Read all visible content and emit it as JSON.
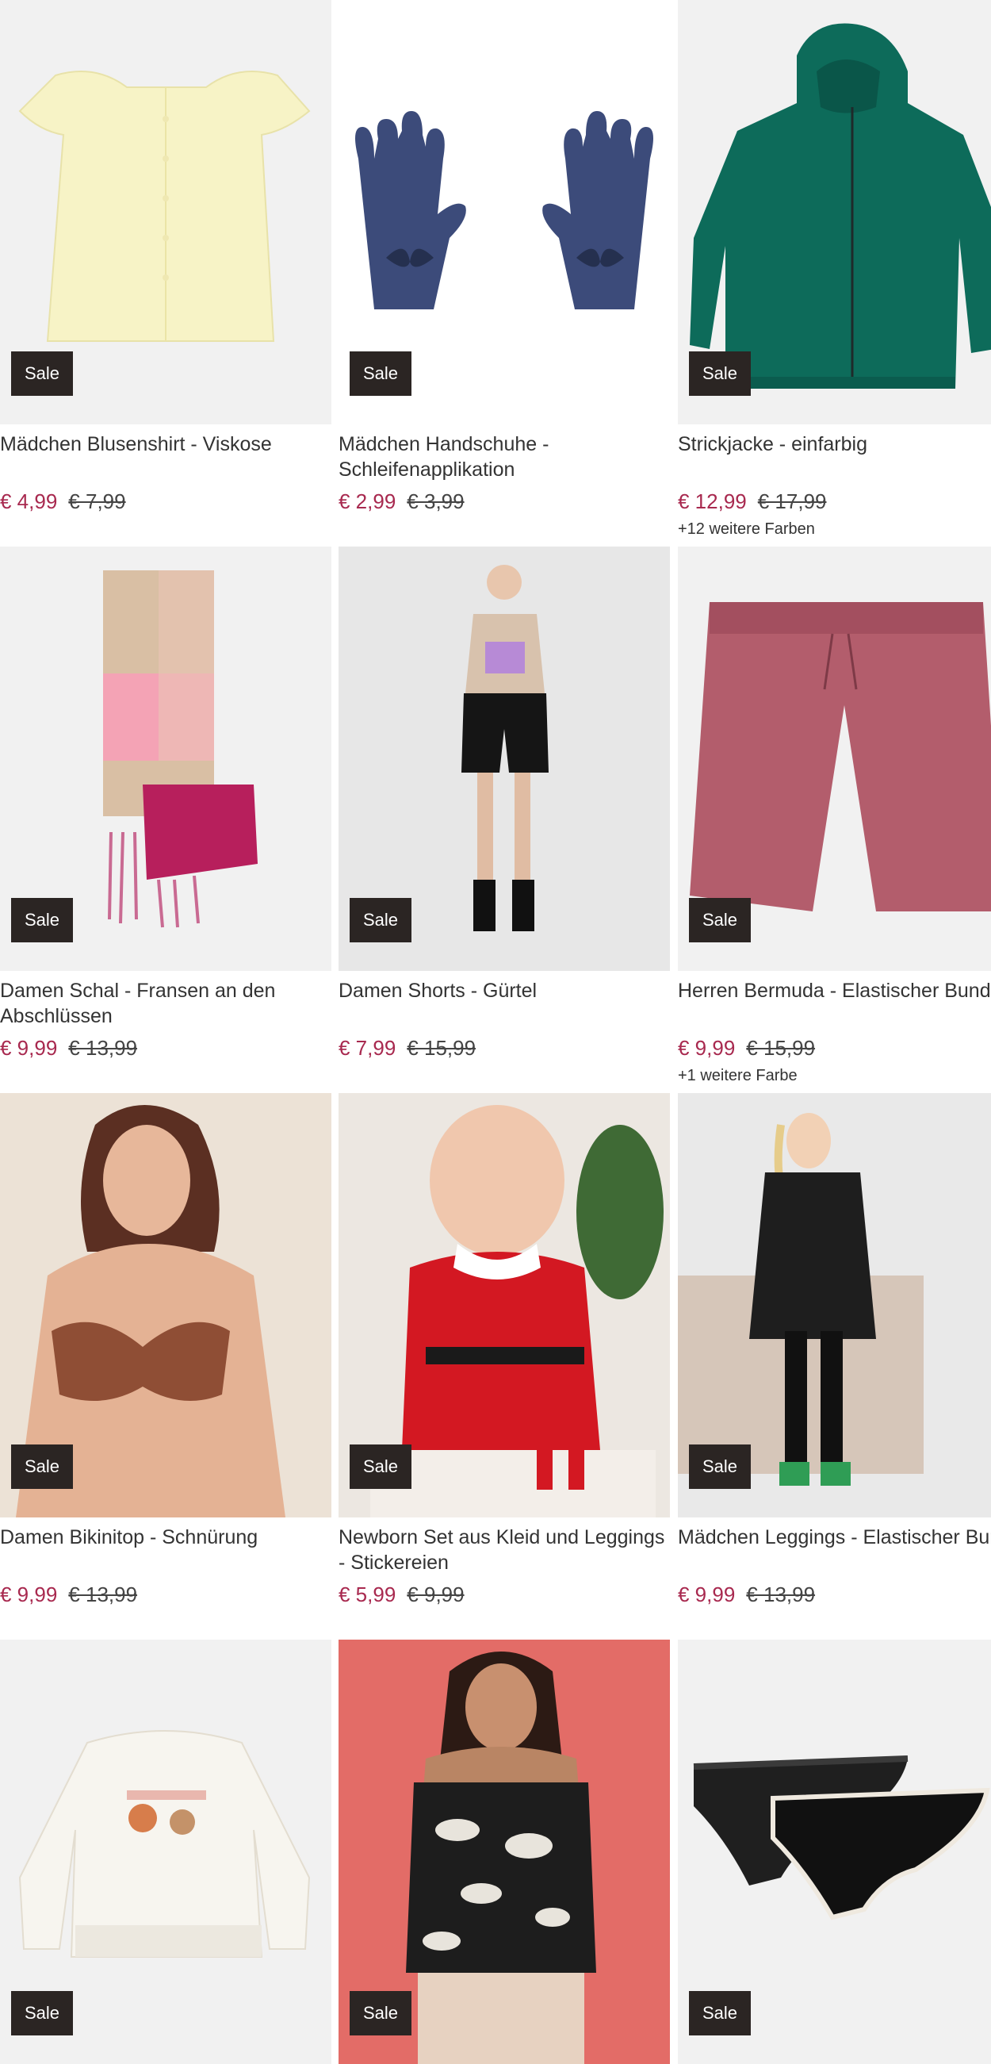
{
  "sale_label": "Sale",
  "currency": "€",
  "colors": {
    "price_now": "#a8294f",
    "sale_badge": "#2b2523",
    "image_bg": "#f1f1f1"
  },
  "products": [
    {
      "title": "Mädchen Blusenshirt - Viskose",
      "price_now": "€ 4,99",
      "price_old": "€ 7,99",
      "more_colors": ""
    },
    {
      "title": "Mädchen Handschuhe - Schleifenapplikation",
      "price_now": "€ 2,99",
      "price_old": "€ 3,99",
      "more_colors": ""
    },
    {
      "title": "Strickjacke - einfarbig",
      "price_now": "€ 12,99",
      "price_old": "€ 17,99",
      "more_colors": "+12 weitere Farben"
    },
    {
      "title": "Damen Schal - Fransen an den Abschlüssen",
      "price_now": "€ 9,99",
      "price_old": "€ 13,99",
      "more_colors": ""
    },
    {
      "title": "Damen Shorts - Gürtel",
      "price_now": "€ 7,99",
      "price_old": "€ 15,99",
      "more_colors": ""
    },
    {
      "title": "Herren Bermuda - Elastischer Bund",
      "price_now": "€ 9,99",
      "price_old": "€ 15,99",
      "more_colors": "+1 weitere Farbe"
    },
    {
      "title": "Damen Bikinitop - Schnürung",
      "price_now": "€ 9,99",
      "price_old": "€ 13,99",
      "more_colors": ""
    },
    {
      "title": "Newborn Set aus Kleid und Leggings - Stickereien",
      "price_now": "€ 5,99",
      "price_old": "€ 9,99",
      "more_colors": ""
    },
    {
      "title": "Mädchen Leggings - Elastischer Bund",
      "price_now": "€ 9,99",
      "price_old": "€ 13,99",
      "more_colors": ""
    },
    {
      "title": "",
      "price_now": "",
      "price_old": "",
      "more_colors": ""
    },
    {
      "title": "",
      "price_now": "",
      "price_old": "",
      "more_colors": ""
    },
    {
      "title": "",
      "price_now": "",
      "price_old": "",
      "more_colors": ""
    }
  ]
}
